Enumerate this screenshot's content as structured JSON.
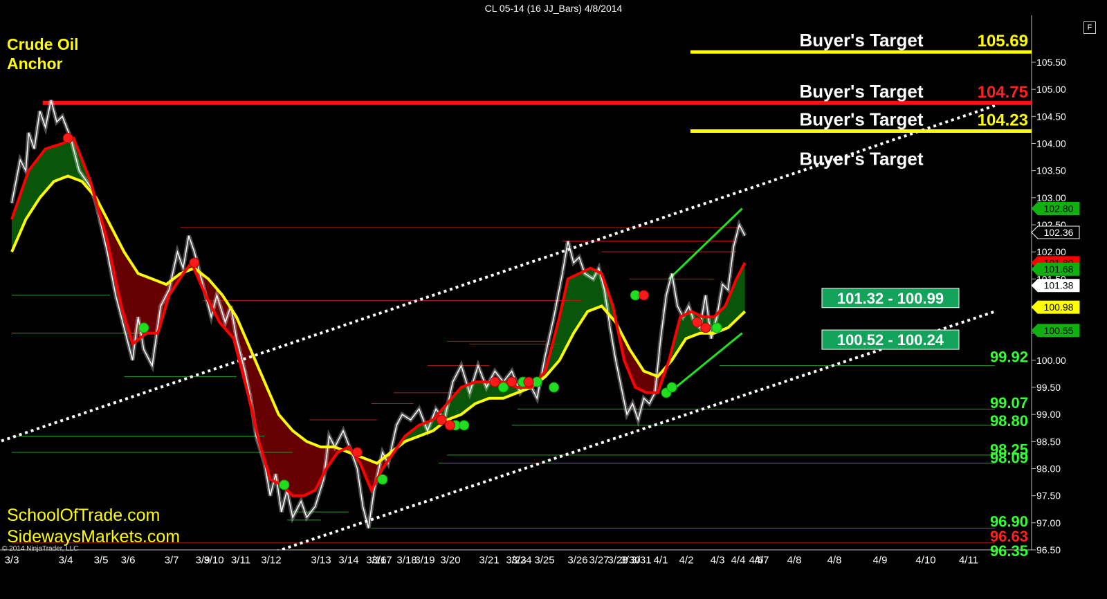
{
  "window": {
    "title": "CL 05-14 (16 JJ_Bars)  4/8/2014",
    "f_label": "F"
  },
  "branding": {
    "line1": "Crude Oil",
    "line2": "Anchor",
    "site1": "SchoolOfTrade.com",
    "site2": "SidewaysMarkets.com",
    "copyright": "© 2014 NinjaTrader, LLC"
  },
  "colors": {
    "background": "#000000",
    "price": "#ffffff",
    "fast_ma": "#ff0000",
    "slow_ma": "#ffff00",
    "bull_fill": "#0a5a0a",
    "bear_fill": "#6b0000",
    "channel": "#ffffff",
    "zone": "#14a35a"
  },
  "chart_data": {
    "type": "line",
    "ylim": [
      96.5,
      106.0
    ],
    "y_ticks": [
      "105.50",
      "105.00",
      "104.50",
      "104.00",
      "103.50",
      "103.00",
      "102.50",
      "102.00",
      "101.50",
      "101.00",
      "100.50",
      "100.00",
      "99.50",
      "99.00",
      "98.50",
      "98.00",
      "97.50",
      "97.00",
      "96.50"
    ],
    "x_labels": [
      "3/3",
      "3/4",
      "3/5",
      "3/6",
      "3/7",
      "3/9",
      "3/10",
      "3/11",
      "3/12",
      "3/13",
      "3/14",
      "3/16",
      "3/17",
      "3/18",
      "3/19",
      "3/20",
      "3/21",
      "3/23",
      "3/24",
      "3/25",
      "3/26",
      "3/27",
      "3/28",
      "3/30",
      "3/31",
      "4/1",
      "4/2",
      "4/3",
      "4/4",
      "4/6",
      "4/7",
      "4/8",
      "4/8",
      "4/9",
      "4/10",
      "4/11"
    ],
    "x_range": [
      0,
      35
    ],
    "price_path": [
      [
        0,
        102.9
      ],
      [
        0.3,
        103.7
      ],
      [
        0.5,
        103.5
      ],
      [
        0.6,
        104.2
      ],
      [
        0.8,
        103.9
      ],
      [
        1.0,
        104.6
      ],
      [
        1.2,
        104.3
      ],
      [
        1.4,
        104.8
      ],
      [
        1.6,
        104.4
      ],
      [
        1.8,
        104.5
      ],
      [
        2.1,
        104.1
      ],
      [
        2.4,
        103.5
      ],
      [
        2.8,
        103.2
      ],
      [
        3.0,
        102.9
      ],
      [
        3.4,
        102.0
      ],
      [
        3.7,
        101.2
      ],
      [
        4.0,
        100.6
      ],
      [
        4.3,
        100.0
      ],
      [
        4.5,
        100.8
      ],
      [
        4.7,
        100.2
      ],
      [
        5.0,
        99.9
      ],
      [
        5.3,
        101.0
      ],
      [
        5.6,
        101.3
      ],
      [
        5.9,
        102.0
      ],
      [
        6.1,
        101.7
      ],
      [
        6.3,
        102.3
      ],
      [
        6.5,
        102.0
      ],
      [
        6.8,
        101.4
      ],
      [
        7.1,
        100.8
      ],
      [
        7.3,
        101.2
      ],
      [
        7.6,
        100.7
      ],
      [
        7.8,
        101.0
      ],
      [
        8.0,
        100.4
      ],
      [
        8.3,
        99.8
      ],
      [
        8.5,
        99.3
      ],
      [
        8.7,
        98.6
      ],
      [
        9.0,
        98.1
      ],
      [
        9.2,
        97.5
      ],
      [
        9.4,
        97.9
      ],
      [
        9.6,
        97.2
      ],
      [
        9.8,
        97.6
      ],
      [
        10.0,
        97.1
      ],
      [
        10.3,
        97.4
      ],
      [
        10.5,
        97.1
      ],
      [
        10.8,
        97.3
      ],
      [
        11.1,
        97.8
      ],
      [
        11.3,
        98.6
      ],
      [
        11.5,
        98.4
      ],
      [
        11.8,
        98.7
      ],
      [
        12.1,
        98.3
      ],
      [
        12.3,
        98.0
      ],
      [
        12.5,
        97.3
      ],
      [
        12.7,
        96.9
      ],
      [
        12.9,
        97.6
      ],
      [
        13.2,
        98.3
      ],
      [
        13.4,
        98.1
      ],
      [
        13.7,
        98.8
      ],
      [
        13.9,
        99.0
      ],
      [
        14.2,
        98.9
      ],
      [
        14.5,
        99.1
      ],
      [
        14.8,
        98.7
      ],
      [
        15.1,
        99.1
      ],
      [
        15.4,
        98.9
      ],
      [
        15.7,
        99.6
      ],
      [
        16.0,
        99.9
      ],
      [
        16.3,
        99.4
      ],
      [
        16.6,
        99.9
      ],
      [
        16.9,
        99.5
      ],
      [
        17.2,
        99.8
      ],
      [
        17.5,
        99.6
      ],
      [
        17.8,
        99.8
      ],
      [
        18.1,
        99.4
      ],
      [
        18.4,
        99.6
      ],
      [
        18.7,
        99.3
      ],
      [
        19.0,
        100.1
      ],
      [
        19.3,
        100.8
      ],
      [
        19.6,
        101.6
      ],
      [
        19.8,
        102.2
      ],
      [
        20.0,
        101.8
      ],
      [
        20.2,
        101.9
      ],
      [
        20.4,
        101.6
      ],
      [
        20.7,
        101.5
      ],
      [
        20.9,
        101.7
      ],
      [
        21.1,
        101.3
      ],
      [
        21.3,
        100.6
      ],
      [
        21.5,
        100.0
      ],
      [
        21.7,
        99.5
      ],
      [
        21.9,
        99.0
      ],
      [
        22.1,
        99.2
      ],
      [
        22.3,
        98.9
      ],
      [
        22.5,
        99.3
      ],
      [
        22.7,
        99.2
      ],
      [
        22.9,
        99.4
      ],
      [
        23.1,
        100.4
      ],
      [
        23.3,
        101.2
      ],
      [
        23.5,
        101.6
      ],
      [
        23.7,
        101.0
      ],
      [
        23.9,
        100.8
      ],
      [
        24.1,
        101.0
      ],
      [
        24.3,
        100.7
      ],
      [
        24.5,
        100.6
      ],
      [
        24.7,
        101.2
      ],
      [
        24.9,
        100.4
      ],
      [
        25.1,
        100.8
      ],
      [
        25.3,
        101.4
      ],
      [
        25.5,
        101.3
      ],
      [
        25.7,
        102.1
      ],
      [
        25.9,
        102.5
      ],
      [
        26.1,
        102.3
      ]
    ],
    "fast_ma": [
      [
        0,
        102.6
      ],
      [
        0.6,
        103.5
      ],
      [
        1.2,
        103.9
      ],
      [
        1.8,
        104.0
      ],
      [
        2.2,
        104.1
      ],
      [
        2.8,
        103.3
      ],
      [
        3.4,
        102.2
      ],
      [
        3.9,
        101.0
      ],
      [
        4.3,
        100.3
      ],
      [
        4.8,
        100.5
      ],
      [
        5.2,
        100.5
      ],
      [
        5.6,
        101.2
      ],
      [
        6.1,
        101.6
      ],
      [
        6.4,
        101.8
      ],
      [
        6.9,
        101.2
      ],
      [
        7.4,
        100.7
      ],
      [
        7.9,
        100.4
      ],
      [
        8.4,
        99.4
      ],
      [
        8.8,
        98.5
      ],
      [
        9.2,
        97.8
      ],
      [
        9.6,
        97.7
      ],
      [
        10.0,
        97.5
      ],
      [
        10.4,
        97.5
      ],
      [
        10.8,
        97.6
      ],
      [
        11.2,
        98.0
      ],
      [
        11.6,
        98.3
      ],
      [
        12.0,
        98.4
      ],
      [
        12.4,
        98.1
      ],
      [
        12.8,
        97.6
      ],
      [
        13.2,
        98.0
      ],
      [
        13.6,
        98.3
      ],
      [
        14.0,
        98.6
      ],
      [
        14.5,
        98.8
      ],
      [
        15.0,
        98.9
      ],
      [
        15.5,
        99.2
      ],
      [
        16.0,
        99.5
      ],
      [
        16.5,
        99.6
      ],
      [
        17.0,
        99.6
      ],
      [
        17.5,
        99.6
      ],
      [
        18.0,
        99.5
      ],
      [
        18.5,
        99.5
      ],
      [
        19.0,
        99.8
      ],
      [
        19.5,
        100.8
      ],
      [
        19.8,
        101.5
      ],
      [
        20.2,
        101.6
      ],
      [
        20.6,
        101.7
      ],
      [
        21.0,
        101.6
      ],
      [
        21.4,
        101.0
      ],
      [
        21.8,
        100.0
      ],
      [
        22.2,
        99.5
      ],
      [
        22.6,
        99.4
      ],
      [
        23.0,
        99.4
      ],
      [
        23.4,
        100.0
      ],
      [
        23.8,
        100.8
      ],
      [
        24.2,
        100.9
      ],
      [
        24.6,
        100.8
      ],
      [
        25.0,
        100.8
      ],
      [
        25.4,
        101.0
      ],
      [
        25.8,
        101.5
      ],
      [
        26.1,
        101.8
      ]
    ],
    "slow_ma": [
      [
        0,
        102.0
      ],
      [
        0.5,
        102.6
      ],
      [
        1.0,
        103.0
      ],
      [
        1.5,
        103.3
      ],
      [
        2.0,
        103.4
      ],
      [
        2.5,
        103.3
      ],
      [
        3.0,
        103.0
      ],
      [
        3.5,
        102.5
      ],
      [
        4.0,
        102.0
      ],
      [
        4.5,
        101.6
      ],
      [
        5.0,
        101.5
      ],
      [
        5.5,
        101.4
      ],
      [
        6.0,
        101.6
      ],
      [
        6.5,
        101.7
      ],
      [
        7.0,
        101.5
      ],
      [
        7.5,
        101.2
      ],
      [
        8.0,
        100.8
      ],
      [
        8.5,
        100.2
      ],
      [
        9.0,
        99.6
      ],
      [
        9.5,
        99.0
      ],
      [
        10.0,
        98.7
      ],
      [
        10.5,
        98.5
      ],
      [
        11.0,
        98.4
      ],
      [
        11.5,
        98.4
      ],
      [
        12.0,
        98.3
      ],
      [
        12.5,
        98.2
      ],
      [
        13.0,
        98.1
      ],
      [
        13.5,
        98.3
      ],
      [
        14.0,
        98.5
      ],
      [
        14.5,
        98.6
      ],
      [
        15.0,
        98.7
      ],
      [
        15.5,
        98.9
      ],
      [
        16.0,
        99.0
      ],
      [
        16.5,
        99.2
      ],
      [
        17.0,
        99.3
      ],
      [
        17.5,
        99.3
      ],
      [
        18.0,
        99.4
      ],
      [
        18.5,
        99.5
      ],
      [
        19.0,
        99.7
      ],
      [
        19.5,
        100.0
      ],
      [
        20.0,
        100.5
      ],
      [
        20.5,
        100.9
      ],
      [
        21.0,
        101.0
      ],
      [
        21.5,
        100.7
      ],
      [
        22.0,
        100.2
      ],
      [
        22.5,
        99.8
      ],
      [
        23.0,
        99.7
      ],
      [
        23.5,
        100.0
      ],
      [
        24.0,
        100.4
      ],
      [
        24.5,
        100.5
      ],
      [
        25.0,
        100.5
      ],
      [
        25.5,
        100.6
      ],
      [
        26.1,
        100.9
      ]
    ],
    "green_dots": [
      [
        4.7,
        100.6
      ],
      [
        9.7,
        97.7
      ],
      [
        13.2,
        97.8
      ],
      [
        15.8,
        98.8
      ],
      [
        16.1,
        98.8
      ],
      [
        17.5,
        99.5
      ],
      [
        18.2,
        99.6
      ],
      [
        18.7,
        99.6
      ],
      [
        19.3,
        99.5
      ],
      [
        22.2,
        101.2
      ],
      [
        23.3,
        99.4
      ],
      [
        23.5,
        99.5
      ],
      [
        25.1,
        100.6
      ]
    ],
    "red_dots": [
      [
        2.0,
        104.1
      ],
      [
        6.5,
        101.8
      ],
      [
        12.3,
        98.3
      ],
      [
        15.3,
        98.9
      ],
      [
        15.6,
        98.8
      ],
      [
        17.2,
        99.6
      ],
      [
        17.8,
        99.6
      ],
      [
        18.4,
        99.6
      ],
      [
        22.5,
        101.2
      ],
      [
        24.4,
        100.7
      ],
      [
        24.7,
        100.6
      ]
    ],
    "resistance_line": {
      "y": 104.75,
      "x_start": 1.1
    },
    "channel_upper": [
      [
        -1,
        98.4
      ],
      [
        35,
        104.7
      ]
    ],
    "channel_lower": [
      [
        9,
        96.4
      ],
      [
        35,
        100.9
      ]
    ],
    "green_lines": [
      [
        [
          23.4,
          101.5
        ],
        [
          26.0,
          102.8
        ]
      ],
      [
        [
          23.4,
          99.4
        ],
        [
          26.0,
          100.5
        ]
      ]
    ],
    "level_lines": [
      {
        "y": 102.45,
        "x0": 6.0,
        "x1": 26.0,
        "color": "red"
      },
      {
        "y": 102.2,
        "x0": 19.6,
        "x1": 25.8,
        "color": "red"
      },
      {
        "y": 102.0,
        "x0": 21.0,
        "x1": 25.8,
        "color": "red"
      },
      {
        "y": 101.5,
        "x0": 22.0,
        "x1": 25.0,
        "color": "red"
      },
      {
        "y": 101.1,
        "x0": 6.8,
        "x1": 20.3,
        "color": "red"
      },
      {
        "y": 101.2,
        "x0": 0.0,
        "x1": 3.5,
        "color": "green"
      },
      {
        "y": 100.5,
        "x0": 0.0,
        "x1": 4.6,
        "color": "green"
      },
      {
        "y": 99.7,
        "x0": 4.0,
        "x1": 8.0,
        "color": "green"
      },
      {
        "y": 99.9,
        "x0": 25.2,
        "x1": 35.0,
        "color": "green"
      },
      {
        "y": 100.35,
        "x0": 15.5,
        "x1": 19.0,
        "color": "red"
      },
      {
        "y": 100.3,
        "x0": 16.3,
        "x1": 19.5,
        "color": "red"
      },
      {
        "y": 99.9,
        "x0": 14.8,
        "x1": 17.0,
        "color": "red"
      },
      {
        "y": 99.4,
        "x0": 13.6,
        "x1": 16.0,
        "color": "red"
      },
      {
        "y": 99.2,
        "x0": 12.8,
        "x1": 14.3,
        "color": "red"
      },
      {
        "y": 98.9,
        "x0": 10.6,
        "x1": 13.0,
        "color": "red"
      },
      {
        "y": 99.1,
        "x0": 18.0,
        "x1": 35.0,
        "color": "green"
      },
      {
        "y": 98.8,
        "x0": 17.8,
        "x1": 35.0,
        "color": "green"
      },
      {
        "y": 98.6,
        "x0": 0.0,
        "x1": 9.0,
        "color": "green"
      },
      {
        "y": 98.3,
        "x0": 0.0,
        "x1": 10.0,
        "color": "green"
      },
      {
        "y": 98.25,
        "x0": 15.5,
        "x1": 35.0,
        "color": "green"
      },
      {
        "y": 98.1,
        "x0": 15.2,
        "x1": 35.0,
        "color": "green"
      },
      {
        "y": 97.2,
        "x0": 10.0,
        "x1": 12.0,
        "color": "green"
      },
      {
        "y": 97.05,
        "x0": 9.8,
        "x1": 11.0,
        "color": "green"
      },
      {
        "y": 96.9,
        "x0": 12.8,
        "x1": 35.0,
        "color": "green"
      },
      {
        "y": 96.63,
        "x0": 0.0,
        "x1": 35.0,
        "color": "red"
      }
    ],
    "targets": [
      {
        "label": "Buyer's Target",
        "value": "105.69",
        "y": 105.69,
        "value_color": "#ffff00",
        "line": true
      },
      {
        "label": "Buyer's Target",
        "value": "104.75",
        "y": 104.75,
        "value_color": "#ff2020",
        "line": false
      },
      {
        "label": "Buyer's Target",
        "value": "104.23",
        "y": 104.23,
        "value_color": "#ffff00",
        "line": true
      },
      {
        "label": "Buyer's Target",
        "value": "",
        "y": 103.5,
        "value_color": "#ffff00",
        "line": false
      }
    ],
    "zones": [
      {
        "label": "101.32 - 100.99",
        "y": 101.15
      },
      {
        "label": "100.52 - 100.24",
        "y": 100.38
      }
    ],
    "level_labels": [
      {
        "text": "99.92",
        "y": 100.08
      },
      {
        "text": "99.07",
        "y": 99.23
      },
      {
        "text": "98.80",
        "y": 98.9
      },
      {
        "text": "98.25",
        "y": 98.37
      },
      {
        "text": "98.09",
        "y": 98.22
      },
      {
        "text": "96.90",
        "y": 97.04
      },
      {
        "text": "96.63",
        "y": 96.77,
        "color": "red"
      },
      {
        "text": "96.35",
        "y": 96.5
      }
    ],
    "axis_markers": [
      {
        "text": "102.80",
        "y": 102.8,
        "bg": "#10b010",
        "fg": "#000000"
      },
      {
        "text": "102.36",
        "y": 102.36,
        "bg": "#000000",
        "fg": "#ffffff",
        "border": "#ffffff"
      },
      {
        "text": "101.80",
        "y": 101.8,
        "bg": "#ff0000",
        "fg": "#000000"
      },
      {
        "text": "101.68",
        "y": 101.68,
        "bg": "#10b010",
        "fg": "#000000"
      },
      {
        "text": "101.38",
        "y": 101.38,
        "bg": "#ffffff",
        "fg": "#000000"
      },
      {
        "text": "100.98",
        "y": 100.98,
        "bg": "#ffff00",
        "fg": "#000000"
      },
      {
        "text": "100.55",
        "y": 100.55,
        "bg": "#10b010",
        "fg": "#000000"
      }
    ]
  }
}
